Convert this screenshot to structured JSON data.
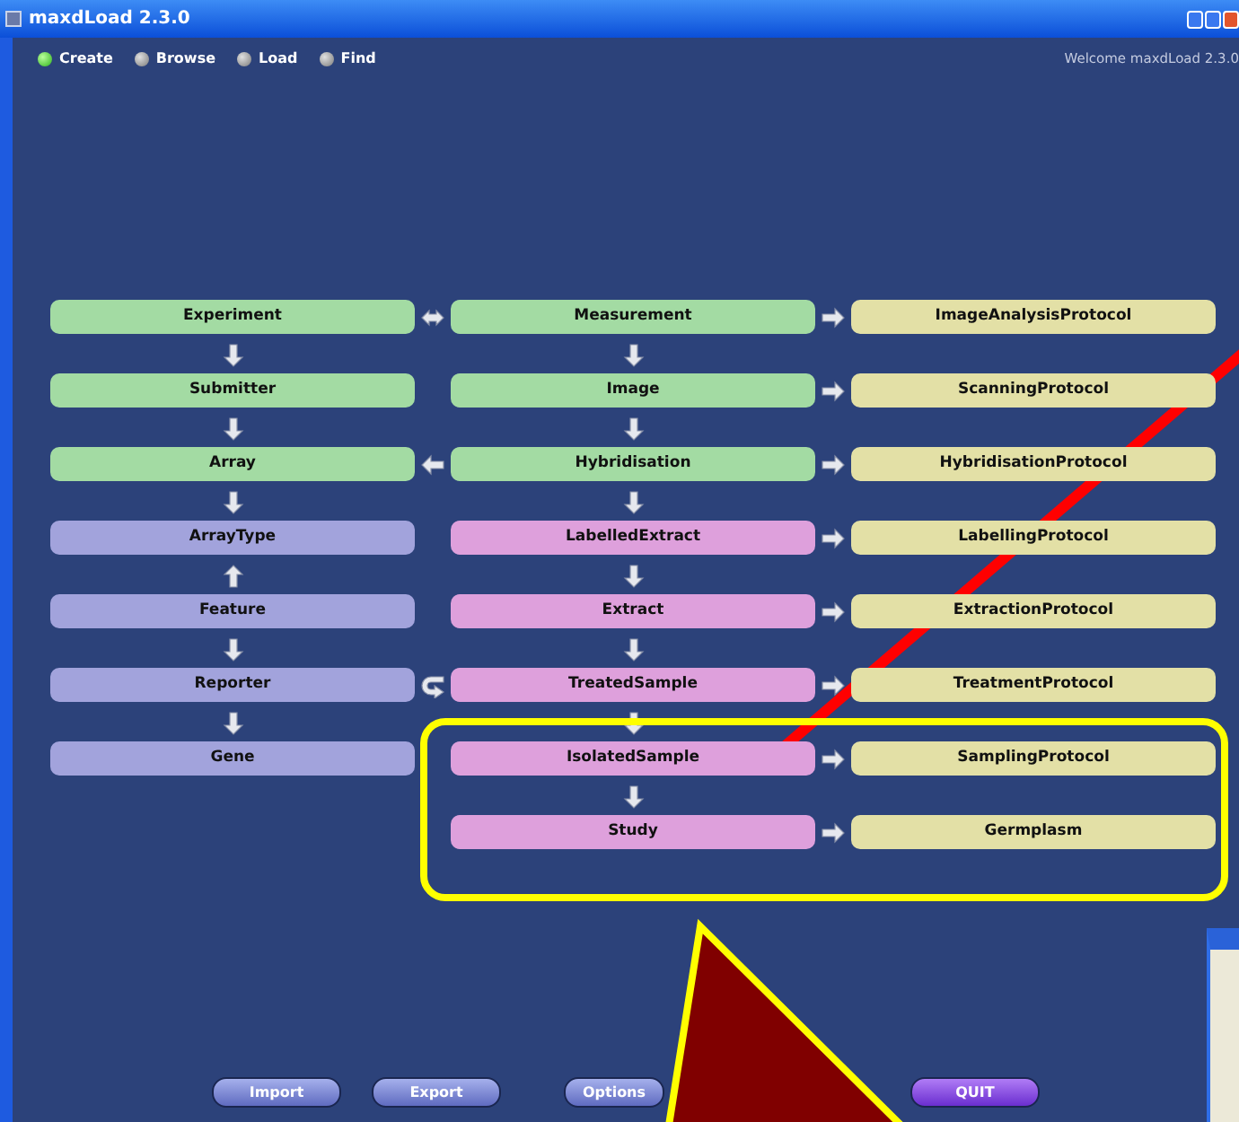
{
  "window": {
    "title": "maxdLoad 2.3.0"
  },
  "modes": [
    {
      "label": "Create",
      "selected": true
    },
    {
      "label": "Browse",
      "selected": false
    },
    {
      "label": "Load",
      "selected": false
    },
    {
      "label": "Find",
      "selected": false
    }
  ],
  "welcome": "Welcome maxdLoad 2.3.0",
  "diagram": {
    "columns": [
      [
        {
          "label": "Experiment",
          "color": "#a3dba3"
        },
        {
          "label": "Submitter",
          "color": "#a3dba3"
        },
        {
          "label": "Array",
          "color": "#a3dba3"
        },
        {
          "label": "ArrayType",
          "color": "#a2a3dc"
        },
        {
          "label": "Feature",
          "color": "#a2a3dc"
        },
        {
          "label": "Reporter",
          "color": "#a2a3dc"
        },
        {
          "label": "Gene",
          "color": "#a2a3dc"
        }
      ],
      [
        {
          "label": "Measurement",
          "color": "#a3dba3"
        },
        {
          "label": "Image",
          "color": "#a3dba3"
        },
        {
          "label": "Hybridisation",
          "color": "#a3dba3"
        },
        {
          "label": "LabelledExtract",
          "color": "#dea0dc"
        },
        {
          "label": "Extract",
          "color": "#dea0dc"
        },
        {
          "label": "TreatedSample",
          "color": "#dea0dc"
        },
        {
          "label": "IsolatedSample",
          "color": "#dea0dc"
        },
        {
          "label": "Study",
          "color": "#dea0dc"
        }
      ],
      [
        {
          "label": "ImageAnalysisProtocol",
          "color": "#e3e0a6"
        },
        {
          "label": "ScanningProtocol",
          "color": "#e3e0a6"
        },
        {
          "label": "HybridisationProtocol",
          "color": "#e3e0a6"
        },
        {
          "label": "LabellingProtocol",
          "color": "#e3e0a6"
        },
        {
          "label": "ExtractionProtocol",
          "color": "#e3e0a6"
        },
        {
          "label": "TreatmentProtocol",
          "color": "#e3e0a6"
        },
        {
          "label": "SamplingProtocol",
          "color": "#e3e0a6"
        },
        {
          "label": "Germplasm",
          "color": "#e3e0a6"
        }
      ]
    ]
  },
  "buttons": [
    {
      "label": "Import",
      "kind": "normal"
    },
    {
      "label": "Export",
      "kind": "normal"
    },
    {
      "label": "Options",
      "kind": "normal"
    },
    {
      "label": "QUIT",
      "kind": "quit"
    }
  ]
}
